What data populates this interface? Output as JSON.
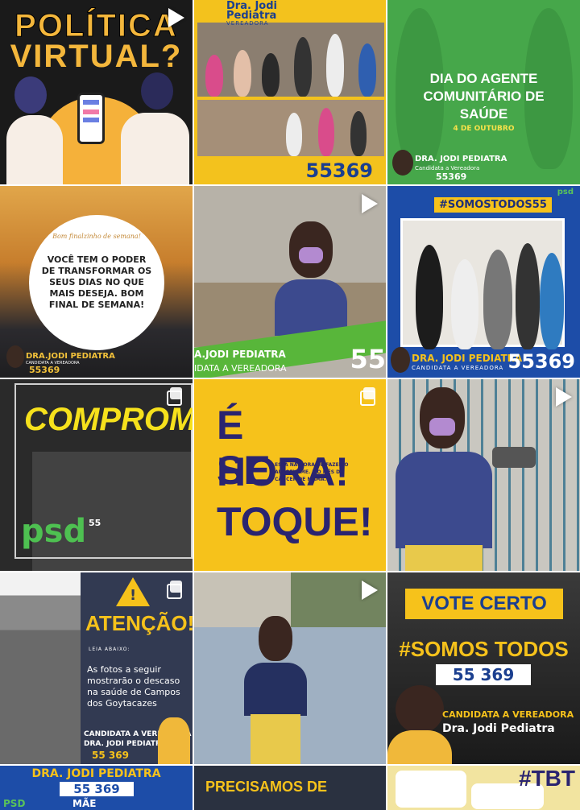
{
  "tiles": {
    "t1": {
      "title_line1": "POLÍTICA",
      "title_line2": "VIRTUAL?"
    },
    "t2": {
      "name_line1": "Dra. Jodi",
      "name_line2": "Pediatra",
      "role": "VEREADORA",
      "number": "55369"
    },
    "t3": {
      "line1": "DIA DO AGENTE",
      "line2": "COMUNITÁRIO DE",
      "line3": "SAÚDE",
      "date": "4 DE OUTUBRO",
      "name": "DRA. JODI PEDIATRA",
      "role": "Candidata a Vereadora",
      "number": "55369"
    },
    "t4": {
      "greeting": "Bom finalzinho de semana!",
      "message": "VOCÊ TEM O PODER DE TRANSFORMAR OS SEUS DIAS NO QUE MAIS DESEJA. BOM FINAL DE SEMANA!",
      "name": "DRA.JODI PEDIATRA",
      "role": "CANDIDATA A VEREADORA",
      "number": "55369"
    },
    "t5": {
      "name": "A.JODI PEDIATRA",
      "role": "IDATA A VEREADORA",
      "number": "55"
    },
    "t6": {
      "hashtag": "#SOMOSTODOS55",
      "logo": "psd",
      "name": "DRA. JODI PEDIATRA",
      "role": "CANDIDATA A VEREADORA",
      "number": "55369"
    },
    "t7": {
      "text": "COMPROM",
      "logo": "psd",
      "logo_number": "55"
    },
    "t8": {
      "line1": "É HORA!",
      "line2": "SE",
      "line3": "TOQUE!",
      "note": "ESTÁ NA HORA DE FAZER O AUTOEXAME. É O MÊS DO CÂNCER DE MAMA."
    },
    "t10": {
      "title": "ATENÇÃO!",
      "sub": "LEIA ABAIXO:",
      "body": "As fotos a seguir mostrarão o descaso na saúde de Campos dos Goytacazes",
      "role": "CANDIDATA A VEREADORA",
      "name": "DRA. JODI PEDIATRA",
      "number": "55 369"
    },
    "t12": {
      "banner": "VOTE CERTO",
      "hashtag": "#SOMOS TODOS",
      "number": "55 369",
      "role": "CANDIDATA A VEREADORA",
      "name": "Dra. Jodi Pediatra"
    },
    "t13": {
      "name": "DRA. JODI PEDIATRA",
      "number": "55 369",
      "logo": "PSD",
      "extra": "MÃE"
    },
    "t14": {
      "text": "PRECISAMOS DE"
    },
    "t15": {
      "text": "#TBT"
    }
  },
  "colors": {
    "yellow": "#f6c21b",
    "blue": "#1b3f8f",
    "green": "#3aa64a",
    "navy": "#2a2470"
  }
}
